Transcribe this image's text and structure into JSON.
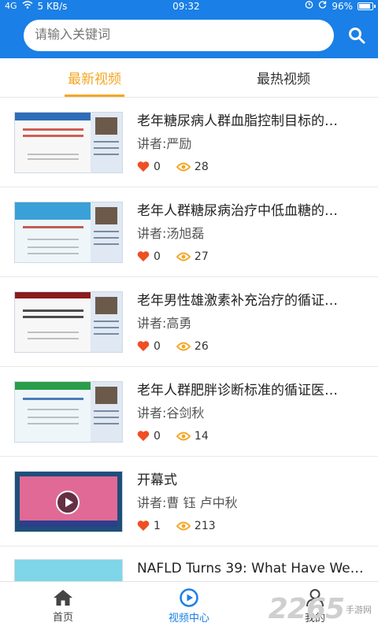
{
  "status_bar": {
    "signal": "4G",
    "speed": "5 KB/s",
    "time": "09:32",
    "battery": "96%",
    "battery_level": 0.96
  },
  "search": {
    "placeholder": "请输入关键词"
  },
  "tabs": [
    {
      "label": "最新视频",
      "active": true
    },
    {
      "label": "最热视频",
      "active": false
    }
  ],
  "videos": [
    {
      "title": "老年糖尿病人群血脂控制目标的…",
      "speaker_prefix": "讲者:",
      "speaker": "严励",
      "likes": "0",
      "views": "28"
    },
    {
      "title": "老年人群糖尿病治疗中低血糖的…",
      "speaker_prefix": "讲者:",
      "speaker": "汤旭磊",
      "likes": "0",
      "views": "27"
    },
    {
      "title": "老年男性雄激素补充治疗的循证…",
      "speaker_prefix": "讲者:",
      "speaker": "高勇",
      "likes": "0",
      "views": "26"
    },
    {
      "title": "老年人群肥胖诊断标准的循证医…",
      "speaker_prefix": "讲者:",
      "speaker": "谷剑秋",
      "likes": "0",
      "views": "14"
    },
    {
      "title": "开幕式",
      "speaker_prefix": "讲者:",
      "speaker": "曹 钰 卢中秋",
      "likes": "1",
      "views": "213"
    },
    {
      "title": "NAFLD Turns 39: What Have We…",
      "speaker_prefix": "",
      "speaker": "",
      "likes": "",
      "views": ""
    }
  ],
  "bottom_nav": [
    {
      "label": "首页",
      "icon": "home-icon",
      "active": false
    },
    {
      "label": "视频中心",
      "icon": "play-circle-icon",
      "active": true
    },
    {
      "label": "我的",
      "icon": "user-icon",
      "active": false
    }
  ],
  "watermark": {
    "number": "2265",
    "text": "手游网"
  },
  "colors": {
    "primary": "#1a7fe6",
    "accent": "#f5a623",
    "like": "#f04e23",
    "view": "#f5a623"
  }
}
